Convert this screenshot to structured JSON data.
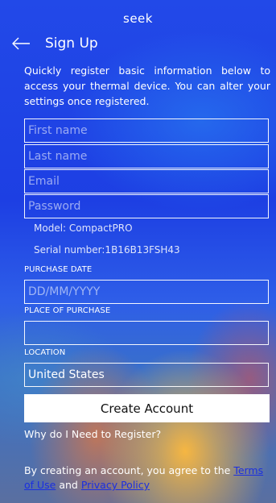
{
  "app": {
    "brand": "seek"
  },
  "header": {
    "back_icon": "arrow-left-icon",
    "title": "Sign Up"
  },
  "intro": {
    "text": "Quickly register basic information below to access your thermal device. You can alter your settings once registered."
  },
  "form": {
    "first_name": {
      "placeholder": "First name",
      "value": ""
    },
    "last_name": {
      "placeholder": "Last name",
      "value": ""
    },
    "email": {
      "placeholder": "Email",
      "value": ""
    },
    "password": {
      "placeholder": "Password",
      "value": ""
    },
    "model_text": "Model: CompactPRO",
    "serial_text": "Serial number:1B16B13FSH43",
    "purchase_date": {
      "label": "PURCHASE DATE",
      "placeholder": "DD/MM/YYYY",
      "value": ""
    },
    "place_of_purchase": {
      "label": "PLACE OF PURCHASE",
      "value": ""
    },
    "location": {
      "label": "LOCATION",
      "value": "United States"
    }
  },
  "actions": {
    "create_account_label": "Create Account",
    "why_register_label": "Why do I Need to Register?"
  },
  "legal": {
    "prefix": "By creating an account, you agree to the ",
    "terms_label": "Terms of Use",
    "joiner": " and ",
    "privacy_label": "Privacy Policy"
  },
  "colors": {
    "link": "#1a2fe0",
    "background_primary": "#2249e8",
    "button_bg": "#ffffff"
  }
}
